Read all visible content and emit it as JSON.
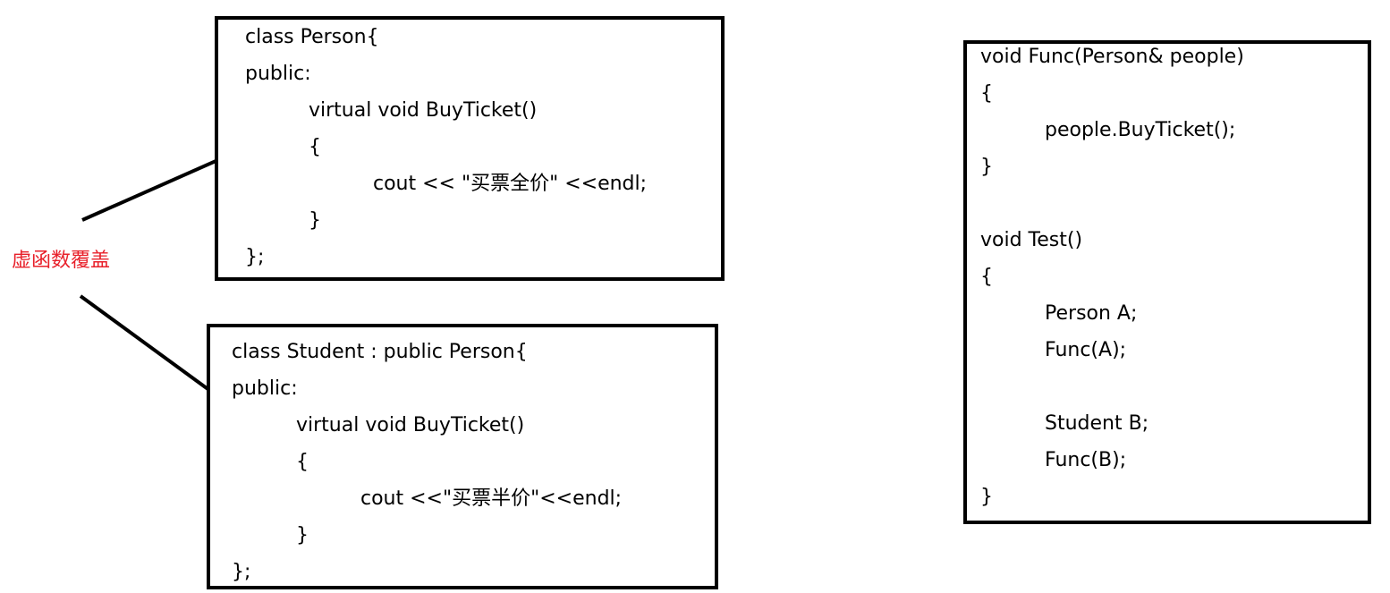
{
  "annotation": {
    "text": "虚函数覆盖",
    "color": "#e8202a"
  },
  "person_class": {
    "lines": [
      "class Person{",
      "public:",
      "virtual void BuyTicket()",
      "{",
      "cout << \"买票全价\" <<endl;",
      "}",
      "};"
    ]
  },
  "student_class": {
    "lines": [
      "class Student : public Person{",
      "public:",
      "virtual void BuyTicket()",
      "{",
      "cout <<\"买票半价\"<<endl;",
      "}",
      "};"
    ]
  },
  "test_code": {
    "lines": [
      "void Func(Person& people)",
      "{",
      "people.BuyTicket();",
      "}",
      "void Test()",
      "{",
      "Person A;",
      "Func(A);",
      "Student B;",
      "Func(B);",
      "}"
    ]
  }
}
